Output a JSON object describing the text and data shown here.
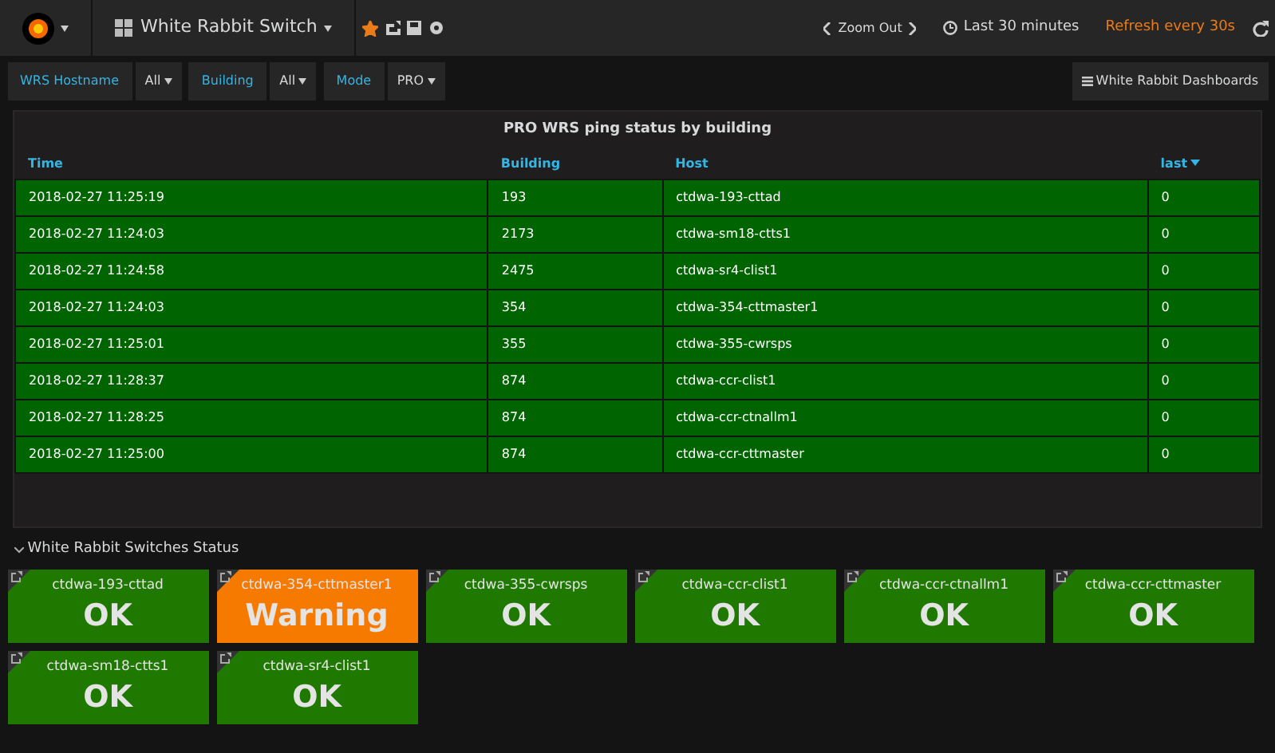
{
  "navbar": {
    "dashboard_title": "White Rabbit Switch",
    "starred": true,
    "zoom_out": "Zoom Out",
    "time_range": "Last 30 minutes",
    "refresh": "Refresh every 30s"
  },
  "variables": [
    {
      "label": "WRS Hostname",
      "value": "All"
    },
    {
      "label": "Building",
      "value": "All"
    },
    {
      "label": "Mode",
      "value": "PRO"
    }
  ],
  "dashboards_link": "White Rabbit Dashboards",
  "table": {
    "title": "PRO WRS ping status by building",
    "columns": [
      {
        "label": "Time",
        "sorted": false
      },
      {
        "label": "Building",
        "sorted": false
      },
      {
        "label": "Host",
        "sorted": false
      },
      {
        "label": "last",
        "sorted": true
      }
    ],
    "rows": [
      [
        "2018-02-27 11:25:19",
        "193",
        "ctdwa-193-cttad",
        "0"
      ],
      [
        "2018-02-27 11:24:03",
        "2173",
        "ctdwa-sm18-ctts1",
        "0"
      ],
      [
        "2018-02-27 11:24:58",
        "2475",
        "ctdwa-sr4-clist1",
        "0"
      ],
      [
        "2018-02-27 11:24:03",
        "354",
        "ctdwa-354-cttmaster1",
        "0"
      ],
      [
        "2018-02-27 11:25:01",
        "355",
        "ctdwa-355-cwrsps",
        "0"
      ],
      [
        "2018-02-27 11:28:37",
        "874",
        "ctdwa-ccr-clist1",
        "0"
      ],
      [
        "2018-02-27 11:28:25",
        "874",
        "ctdwa-ccr-ctnallm1",
        "0"
      ],
      [
        "2018-02-27 11:25:00",
        "874",
        "ctdwa-ccr-cttmaster",
        "0"
      ]
    ]
  },
  "row_title": "White Rabbit Switches Status",
  "switches": [
    {
      "name": "ctdwa-193-cttad",
      "status": "OK",
      "kind": "ok"
    },
    {
      "name": "ctdwa-354-cttmaster1",
      "status": "Warning",
      "kind": "warning"
    },
    {
      "name": "ctdwa-355-cwrsps",
      "status": "OK",
      "kind": "ok"
    },
    {
      "name": "ctdwa-ccr-clist1",
      "status": "OK",
      "kind": "ok"
    },
    {
      "name": "ctdwa-ccr-ctnallm1",
      "status": "OK",
      "kind": "ok"
    },
    {
      "name": "ctdwa-ccr-cttmaster",
      "status": "OK",
      "kind": "ok"
    },
    {
      "name": "ctdwa-sm18-ctts1",
      "status": "OK",
      "kind": "ok"
    },
    {
      "name": "ctdwa-sr4-clist1",
      "status": "OK",
      "kind": "ok"
    }
  ]
}
